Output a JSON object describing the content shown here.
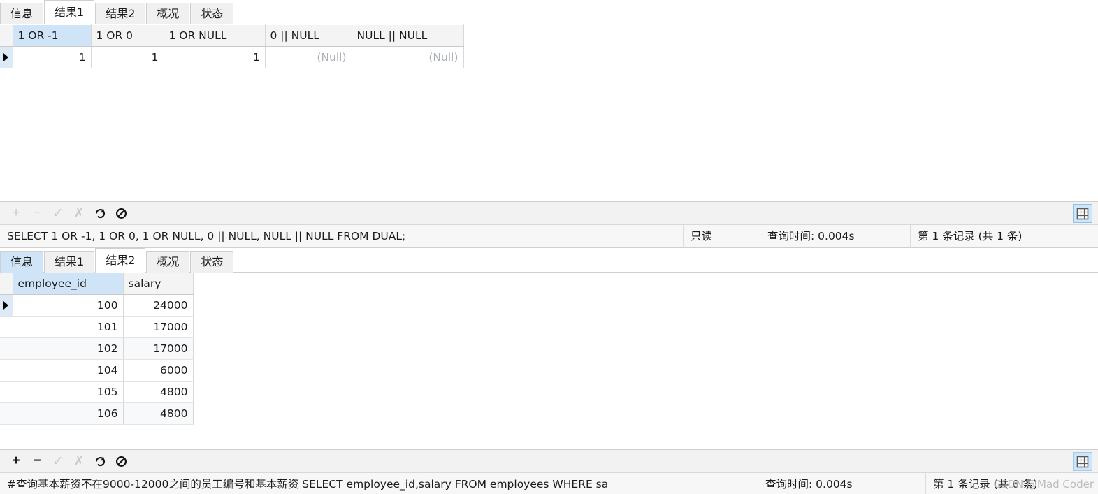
{
  "top_pane": {
    "tabs": [
      {
        "label": "信息",
        "state": "normal"
      },
      {
        "label": "结果1",
        "state": "active"
      },
      {
        "label": "结果2",
        "state": "normal"
      },
      {
        "label": "概况",
        "state": "normal"
      },
      {
        "label": "状态",
        "state": "normal"
      }
    ],
    "grid": {
      "columns": [
        "1 OR -1",
        "1 OR 0",
        "1 OR NULL",
        "0 || NULL",
        "NULL || NULL"
      ],
      "selected_column": "1 OR -1",
      "rows": [
        [
          "1",
          "1",
          "1",
          "(Null)",
          "(Null)"
        ]
      ],
      "null_text": "(Null)"
    },
    "toolbar": {
      "add": "+",
      "remove": "−",
      "confirm": "✓",
      "cancel": "✗",
      "refresh": "refresh-icon",
      "stop": "stop-icon",
      "grid_view": "grid-view-icon"
    },
    "status": {
      "sql": "SELECT 1 OR -1, 1 OR 0, 1 OR NULL, 0 || NULL, NULL || NULL FROM DUAL;",
      "readonly": "只读",
      "query_time": "查询时间: 0.004s",
      "record_info": "第 1 条记录 (共 1 条)"
    }
  },
  "bottom_pane": {
    "tabs": [
      {
        "label": "信息",
        "state": "hilite"
      },
      {
        "label": "结果1",
        "state": "normal"
      },
      {
        "label": "结果2",
        "state": "active"
      },
      {
        "label": "概况",
        "state": "normal"
      },
      {
        "label": "状态",
        "state": "normal"
      }
    ],
    "grid": {
      "columns": [
        "employee_id",
        "salary"
      ],
      "selected_column": "employee_id",
      "rows": [
        [
          "100",
          "24000"
        ],
        [
          "101",
          "17000"
        ],
        [
          "102",
          "17000"
        ],
        [
          "104",
          "6000"
        ],
        [
          "105",
          "4800"
        ],
        [
          "106",
          "4800"
        ]
      ]
    },
    "toolbar": {
      "add": "+",
      "remove": "−",
      "confirm": "✓",
      "cancel": "✗",
      "refresh": "refresh-icon",
      "stop": "stop-icon",
      "grid_view": "grid-view-icon"
    },
    "status": {
      "sql": "#查询基本薪资不在9000-12000之间的员工编号和基本薪资 SELECT employee_id,salary FROM employees WHERE sa",
      "query_time": "查询时间: 0.004s",
      "record_info": "第 1 条记录 (共 6 条)"
    }
  },
  "watermark": {
    "text": "CSDN @Mad Coder"
  },
  "colors": {
    "accent": "#cfe4f7",
    "toolbar_bg": "#f2f2f2",
    "status_bg": "#f7f7f7",
    "null_text": "#a9aeb8"
  }
}
